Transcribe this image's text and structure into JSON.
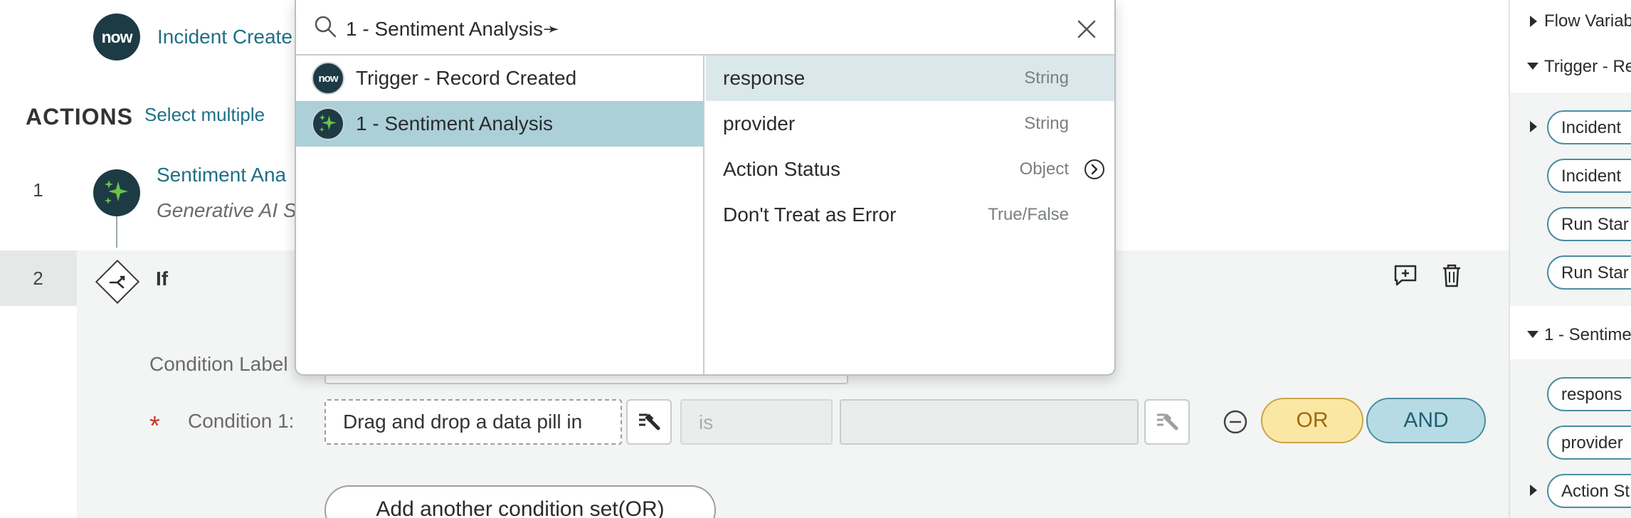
{
  "header": {
    "trigger_label": "Incident Create",
    "logo_text": "now"
  },
  "actions": {
    "title": "ACTIONS",
    "select_multiple": "Select multiple",
    "step1": {
      "number": "1",
      "title": "Sentiment Ana",
      "subtitle": "Generative AI S"
    },
    "step2": {
      "number": "2",
      "title": "If"
    }
  },
  "condition": {
    "label_text": "Condition Label",
    "required_mark": "*",
    "condition1_label": "Condition 1:",
    "drop_placeholder": "Drag and drop a data pill in",
    "operator_placeholder": "is",
    "or_label": "OR",
    "and_label": "AND",
    "add_set_label": "Add another condition set(OR)"
  },
  "popup": {
    "search_value": "1 - Sentiment Analysis➛",
    "left_items": [
      {
        "label": "Trigger - Record Created",
        "icon": "now-logo-icon",
        "selected": false
      },
      {
        "label": "1 - Sentiment Analysis",
        "icon": "sparkle-icon",
        "selected": true
      }
    ],
    "right_items": [
      {
        "name": "response",
        "type": "String",
        "selected": true,
        "has_arrow": false
      },
      {
        "name": "provider",
        "type": "String",
        "selected": false,
        "has_arrow": false
      },
      {
        "name": "Action Status",
        "type": "Object",
        "selected": false,
        "has_arrow": true
      },
      {
        "name": "Don't Treat as Error",
        "type": "True/False",
        "selected": false,
        "has_arrow": false
      }
    ]
  },
  "data_panel": {
    "flow_variables": "Flow Variab",
    "trigger_section": "Trigger - Re",
    "trigger_pills": [
      "Incident",
      "Incident",
      "Run Star",
      "Run Star"
    ],
    "sentiment_section": "1 - Sentime",
    "sentiment_pills": [
      "respons",
      "provider",
      "Action St"
    ]
  },
  "colors": {
    "brand_dark": "#1d3b45",
    "link": "#1f6f86",
    "selected_row": "#abd0d8",
    "or_fill": "#fbe7a4",
    "and_fill": "#b7dbe5",
    "required": "#c0392b"
  }
}
